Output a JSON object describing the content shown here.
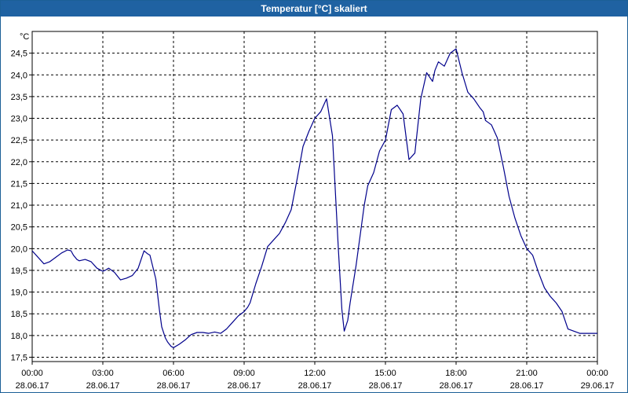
{
  "window": {
    "title": "Temperatur [°C] skaliert"
  },
  "chart_data": {
    "type": "line",
    "title": "Temperatur [°C] skaliert",
    "ylabel": "°C",
    "xlabel": "",
    "ylim": [
      17.4,
      25.0
    ],
    "xlim": [
      0,
      24
    ],
    "grid": true,
    "y_ticks": [
      "17,5",
      "18,0",
      "18,5",
      "19,0",
      "19,5",
      "20,0",
      "20,5",
      "21,0",
      "21,5",
      "22,0",
      "22,5",
      "23,0",
      "23,5",
      "24,0",
      "24,5"
    ],
    "y_tick_values": [
      17.5,
      18.0,
      18.5,
      19.0,
      19.5,
      20.0,
      20.5,
      21.0,
      21.5,
      22.0,
      22.5,
      23.0,
      23.5,
      24.0,
      24.5
    ],
    "x_ticks": [
      {
        "time": "00:00",
        "date": "28.06.17"
      },
      {
        "time": "03:00",
        "date": "28.06.17"
      },
      {
        "time": "06:00",
        "date": "28.06.17"
      },
      {
        "time": "09:00",
        "date": "28.06.17"
      },
      {
        "time": "12:00",
        "date": "28.06.17"
      },
      {
        "time": "15:00",
        "date": "28.06.17"
      },
      {
        "time": "18:00",
        "date": "28.06.17"
      },
      {
        "time": "21:00",
        "date": "28.06.17"
      },
      {
        "time": "00:00",
        "date": "29.06.17"
      }
    ],
    "series": [
      {
        "color": "#00008b",
        "x": [
          0,
          0.5,
          0.75,
          1,
          1.25,
          1.5,
          1.65,
          1.75,
          1.9,
          2,
          2.25,
          2.5,
          2.75,
          3,
          3.1,
          3.25,
          3.5,
          3.75,
          4,
          4.25,
          4.5,
          4.75,
          4.9,
          5,
          5.25,
          5.4,
          5.5,
          5.65,
          5.75,
          5.9,
          6,
          6.25,
          6.5,
          6.75,
          7,
          7.25,
          7.5,
          7.75,
          8,
          8.25,
          8.5,
          8.75,
          9,
          9.15,
          9.25,
          9.5,
          9.75,
          10,
          10.25,
          10.5,
          10.75,
          11,
          11.25,
          11.5,
          11.75,
          12,
          12.25,
          12.5,
          12.75,
          13,
          13.15,
          13.25,
          13.4,
          13.5,
          13.75,
          14,
          14.1,
          14.25,
          14.5,
          14.75,
          15,
          15.25,
          15.5,
          15.75,
          16,
          16.25,
          16.5,
          16.75,
          17,
          17.1,
          17.25,
          17.5,
          17.75,
          18,
          18.25,
          18.5,
          18.75,
          19,
          19.15,
          19.25,
          19.5,
          19.75,
          20,
          20.25,
          20.5,
          20.75,
          21,
          21.25,
          21.5,
          21.75,
          22,
          22.25,
          22.5,
          22.75,
          23,
          23.25,
          23.5,
          23.75,
          24
        ],
        "y": [
          19.95,
          19.65,
          19.7,
          19.8,
          19.9,
          19.97,
          19.95,
          19.85,
          19.75,
          19.72,
          19.75,
          19.7,
          19.55,
          19.48,
          19.5,
          19.55,
          19.45,
          19.28,
          19.32,
          19.38,
          19.55,
          19.95,
          19.88,
          19.85,
          19.3,
          18.6,
          18.2,
          17.95,
          17.85,
          17.75,
          17.72,
          17.8,
          17.9,
          18.02,
          18.07,
          18.07,
          18.05,
          18.08,
          18.05,
          18.15,
          18.3,
          18.45,
          18.55,
          18.65,
          18.75,
          19.2,
          19.6,
          20.05,
          20.2,
          20.35,
          20.6,
          20.9,
          21.6,
          22.35,
          22.7,
          23.0,
          23.15,
          23.45,
          22.6,
          20.0,
          18.6,
          18.1,
          18.35,
          18.75,
          19.6,
          20.6,
          21.0,
          21.45,
          21.75,
          22.25,
          22.5,
          23.2,
          23.3,
          23.1,
          22.05,
          22.2,
          23.45,
          24.05,
          23.85,
          24.1,
          24.3,
          24.2,
          24.5,
          24.6,
          24.05,
          23.6,
          23.45,
          23.25,
          23.15,
          22.95,
          22.85,
          22.55,
          21.9,
          21.2,
          20.7,
          20.3,
          20.0,
          19.85,
          19.45,
          19.1,
          18.9,
          18.75,
          18.55,
          18.15,
          18.1,
          18.05,
          18.05,
          18.05,
          18.05
        ]
      }
    ]
  }
}
